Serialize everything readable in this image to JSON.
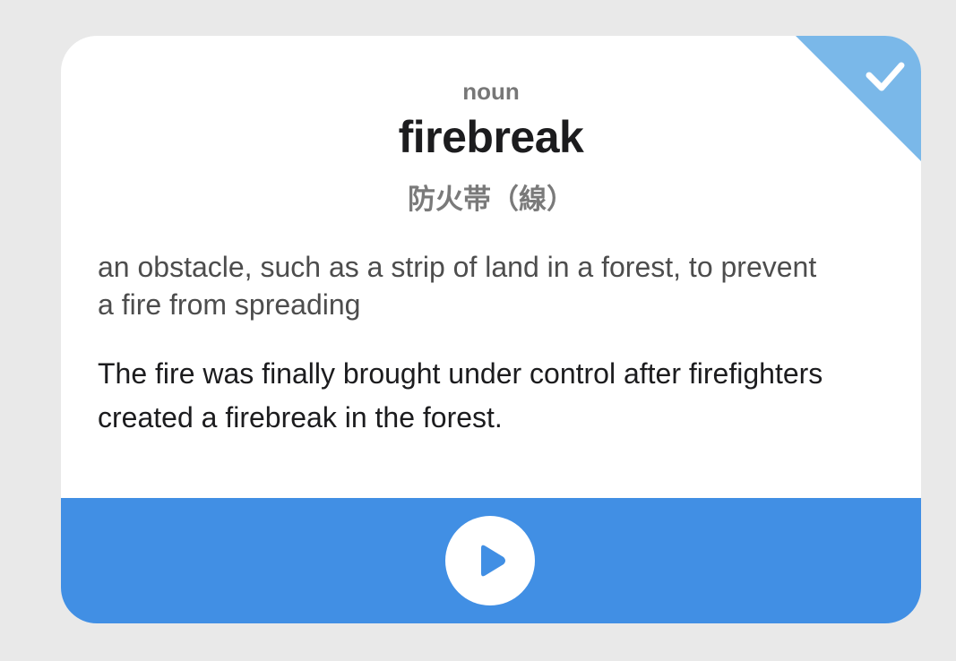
{
  "card": {
    "part_of_speech": "noun",
    "word": "firebreak",
    "translation": "防火帯（線）",
    "definition": "an obstacle, such as a strip of land in a forest, to prevent a fire from spreading",
    "example": "The fire was finally brought under control after firefighters created a firebreak in the forest."
  },
  "status": {
    "learned": true,
    "icon": "checkmark-icon",
    "corner_color": "#7ab8e9"
  },
  "player": {
    "icon": "play-icon",
    "bar_color": "#418fe4"
  }
}
